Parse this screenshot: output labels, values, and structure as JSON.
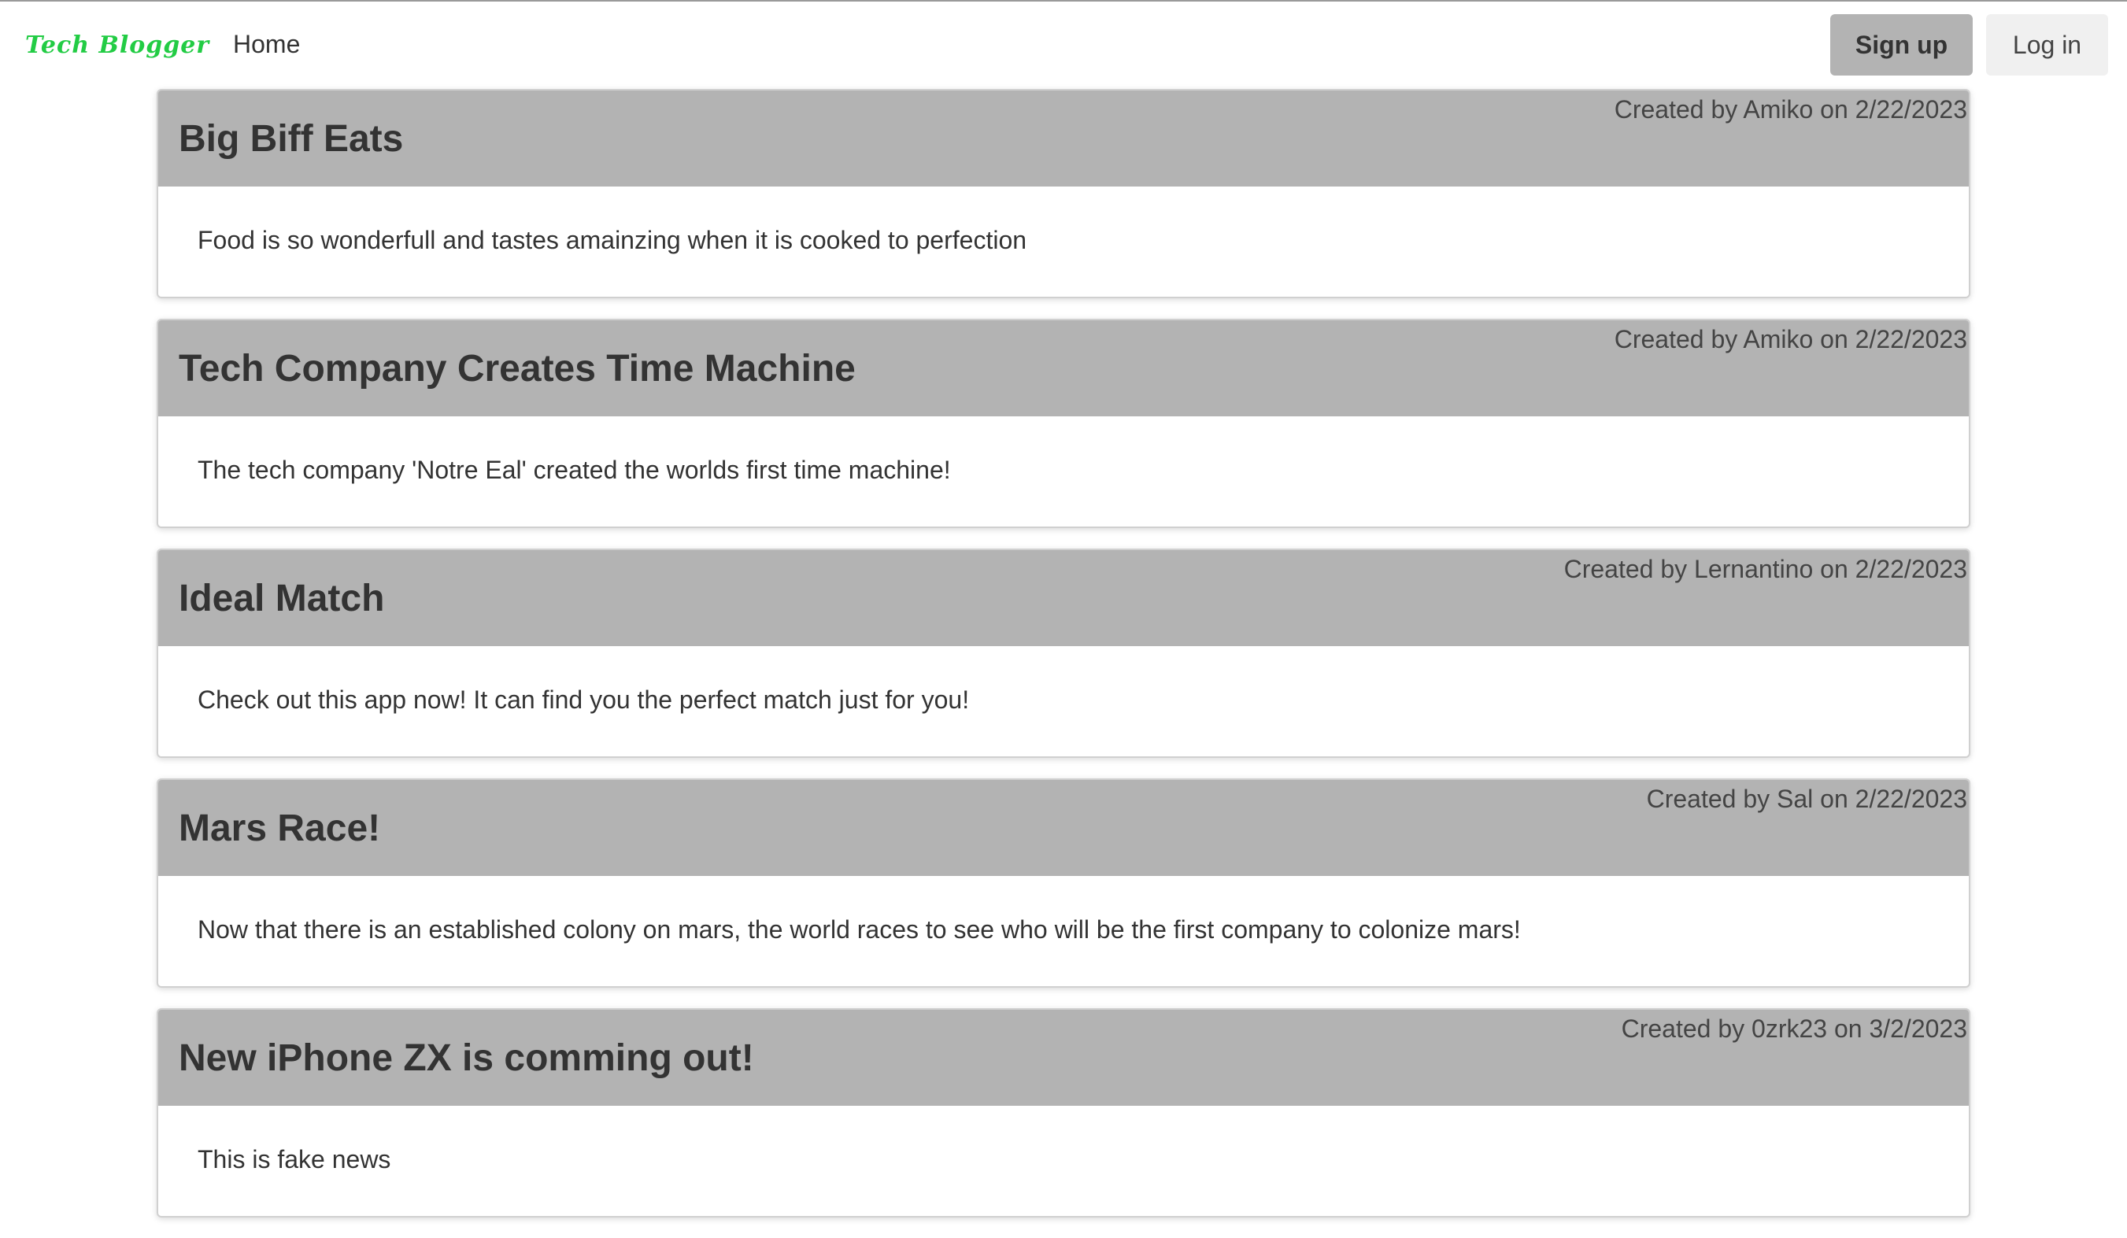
{
  "nav": {
    "brand": "Tech Blogger",
    "home": "Home",
    "signup": "Sign up",
    "login": "Log in"
  },
  "posts": [
    {
      "title": "Big Biff Eats",
      "meta": "Created by Amiko on 2/22/2023",
      "body": "Food is so wonderfull and tastes amainzing when it is cooked to perfection"
    },
    {
      "title": "Tech Company Creates Time Machine",
      "meta": "Created by Amiko on 2/22/2023",
      "body": "The tech company 'Notre Eal' created the worlds first time machine!"
    },
    {
      "title": "Ideal Match",
      "meta": "Created by Lernantino on 2/22/2023",
      "body": "Check out this app now! It can find you the perfect match just for you!"
    },
    {
      "title": "Mars Race!",
      "meta": "Created by Sal on 2/22/2023",
      "body": "Now that there is an established colony on mars, the world races to see who will be the first company to colonize mars!"
    },
    {
      "title": "New iPhone ZX is comming out!",
      "meta": "Created by 0zrk23 on 3/2/2023",
      "body": "This is fake news"
    }
  ],
  "colors": {
    "brand": "#22cc44",
    "header_bg": "#b3b3b3",
    "signup_bg": "#b3b3b3",
    "login_bg": "#f0f0f0"
  }
}
